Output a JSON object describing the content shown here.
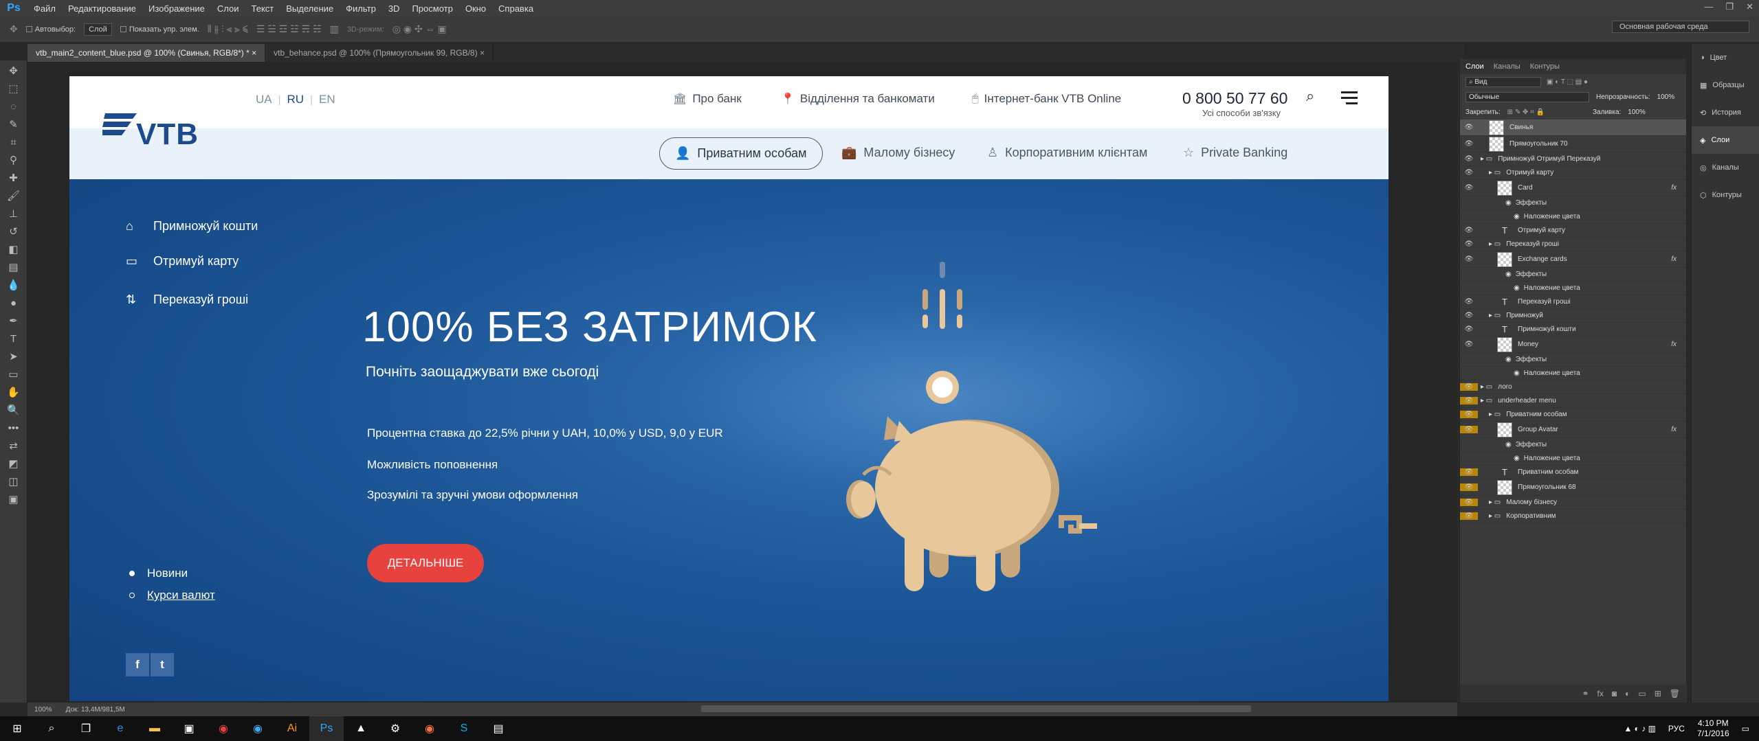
{
  "menu": {
    "app_icon": "Ps",
    "items": [
      "Файл",
      "Редактирование",
      "Изображение",
      "Слои",
      "Текст",
      "Выделение",
      "Фильтр",
      "3D",
      "Просмотр",
      "Окно",
      "Справка"
    ]
  },
  "options": {
    "autoselect_label": "Автовыбор:",
    "autoselect_value": "Слой",
    "show_controls_label": "Показать упр. элем.",
    "mode_3d": "3D-режим:",
    "workspace": "Основная рабочая среда"
  },
  "tabs": [
    {
      "label": "vtb_main2_content_blue.psd @ 100% (Свинья, RGB/8*) *",
      "close": "×"
    },
    {
      "label": "vtb_behance.psd @ 100% (Прямоугольник 99, RGB/8)",
      "close": "×"
    }
  ],
  "status": {
    "zoom": "100%",
    "doc": "Док: 13,4M/981,5M"
  },
  "web": {
    "logo_text": "VTB",
    "langs": [
      "UA",
      "RU",
      "EN"
    ],
    "lang_sep": "|",
    "topnav": [
      "Про банк",
      "Відділення та банкомати",
      "Інтернет-банк VTB Online"
    ],
    "phone": "0 800 50 77 60",
    "phone_sub": "Усі способи зв'язку",
    "subnav": [
      "Приватним особам",
      "Малому бізнесу",
      "Корпоративним клієнтам",
      "Private Banking"
    ],
    "side_links": [
      "Примножуй кошти",
      "Отримуй карту",
      "Переказуй гроші"
    ],
    "hero_title": "100% БЕЗ ЗАТРИМОК",
    "hero_sub": "Почніть заощаджувати вже сьогоді",
    "features": [
      "Процентна ставка до 22,5% річни у UAH, 10,0% у USD, 9,0 у EUR",
      "Можливість поповнення",
      "Зрозумілі та зручні умови оформлення"
    ],
    "cta": "ДЕТАЛЬНІШЕ",
    "radio": [
      "Новини",
      "Курси валют"
    ],
    "social": [
      "f",
      "t"
    ]
  },
  "layers": {
    "tabs": [
      "Слои",
      "Каналы",
      "Контуры"
    ],
    "filter_kind": "Вид",
    "blend_mode": "Обычные",
    "opacity_label": "Непрозрачность:",
    "opacity": "100%",
    "lock_label": "Закрепить:",
    "fill_label": "Заливка:",
    "fill": "100%",
    "rows": [
      {
        "name": "Свинья",
        "indent": 1,
        "type": "thumb",
        "sel": true
      },
      {
        "name": "Прямоугольник 70",
        "indent": 1,
        "type": "thumb"
      },
      {
        "name": "Примножуй Отримуй Переказуй",
        "indent": 0,
        "type": "group"
      },
      {
        "name": "Отримуй карту",
        "indent": 1,
        "type": "group"
      },
      {
        "name": "Card",
        "indent": 2,
        "type": "thumb",
        "fx": "fx"
      },
      {
        "name": "Эффекты",
        "indent": 3,
        "type": "fx"
      },
      {
        "name": "Наложение цвета",
        "indent": 4,
        "type": "fx"
      },
      {
        "name": "Отримуй карту",
        "indent": 2,
        "type": "text"
      },
      {
        "name": "Переказуй гроші",
        "indent": 1,
        "type": "group"
      },
      {
        "name": "Exchange cards",
        "indent": 2,
        "type": "thumb",
        "fx": "fx"
      },
      {
        "name": "Эффекты",
        "indent": 3,
        "type": "fx"
      },
      {
        "name": "Наложение цвета",
        "indent": 4,
        "type": "fx"
      },
      {
        "name": "Переказуй гроші",
        "indent": 2,
        "type": "text"
      },
      {
        "name": "Примножуй",
        "indent": 1,
        "type": "group"
      },
      {
        "name": "Примножуй кошти",
        "indent": 2,
        "type": "text"
      },
      {
        "name": "Money",
        "indent": 2,
        "type": "thumb",
        "fx": "fx"
      },
      {
        "name": "Эффекты",
        "indent": 3,
        "type": "fx"
      },
      {
        "name": "Наложение цвета",
        "indent": 4,
        "type": "fx"
      },
      {
        "name": "лого",
        "indent": 0,
        "type": "group",
        "y": true
      },
      {
        "name": "underheader menu",
        "indent": 0,
        "type": "group",
        "y": true
      },
      {
        "name": "Приватним особам",
        "indent": 1,
        "type": "group",
        "y": true
      },
      {
        "name": "Group Avatar",
        "indent": 2,
        "type": "thumb",
        "fx": "fx",
        "y": true
      },
      {
        "name": "Эффекты",
        "indent": 3,
        "type": "fx",
        "y": true
      },
      {
        "name": "Наложение цвета",
        "indent": 4,
        "type": "fx",
        "y": true
      },
      {
        "name": "Приватним особам",
        "indent": 2,
        "type": "text",
        "y": true
      },
      {
        "name": "Прямоугольник 68",
        "indent": 2,
        "type": "thumb",
        "y": true
      },
      {
        "name": "Малому бізнесу",
        "indent": 1,
        "type": "group",
        "y": true
      },
      {
        "name": "Корпоративним",
        "indent": 1,
        "type": "group",
        "y": true
      }
    ]
  },
  "dock": [
    "Цвет",
    "Образцы",
    "История",
    "Слои",
    "Каналы",
    "Контуры"
  ],
  "tray": {
    "lang": "РУС",
    "time": "4:10 PM",
    "date": "7/1/2016"
  },
  "colors": {
    "accent_red": "#e8423e",
    "brand_blue": "#1c4a8c",
    "hero_blue": "#1d5798"
  }
}
